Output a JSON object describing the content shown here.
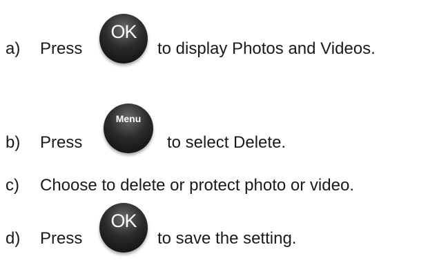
{
  "steps": [
    {
      "marker": "a)",
      "press_text": "Press",
      "button_label": "OK",
      "button_icon": "ok-button-icon",
      "rest_text": "to display Photos and Videos."
    },
    {
      "marker": "b)",
      "press_text": "Press",
      "button_label": "Menu",
      "button_icon": "menu-button-icon",
      "rest_text": "to select Delete."
    },
    {
      "marker": "c)",
      "text": "Choose to delete or protect photo or video."
    },
    {
      "marker": "d)",
      "press_text": "Press",
      "button_label": "OK",
      "button_icon": "ok-button-icon",
      "rest_text": "to save the setting."
    }
  ]
}
